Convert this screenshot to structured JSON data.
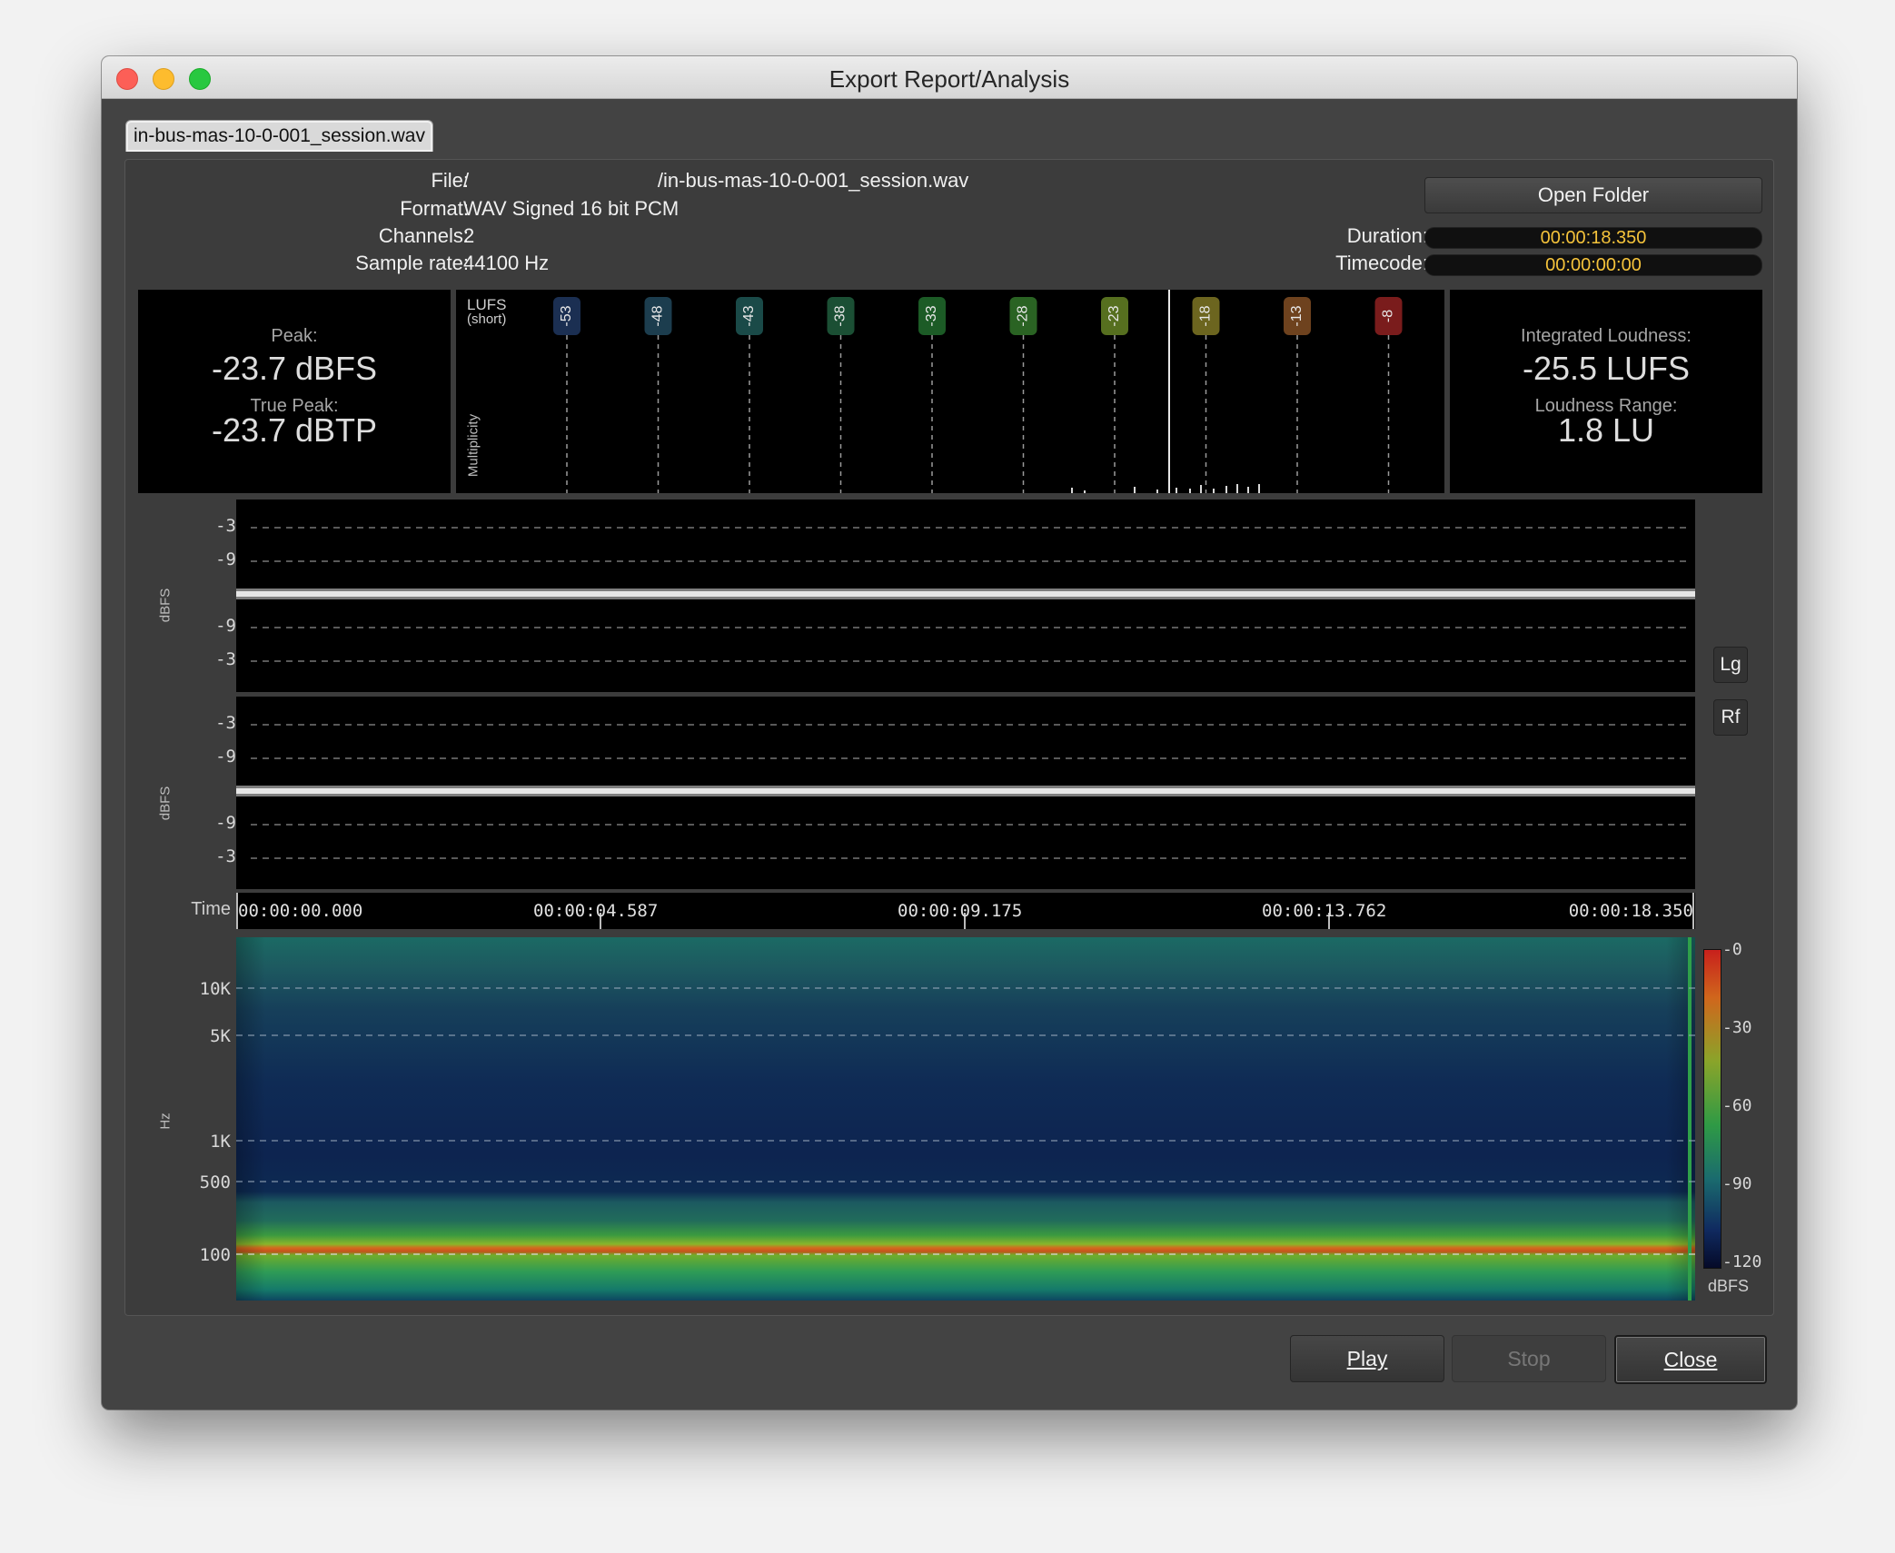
{
  "window": {
    "title": "Export Report/Analysis"
  },
  "tab": {
    "label": "in-bus-mas-10-0-001_session.wav"
  },
  "file_info": {
    "file_label": "File:",
    "file_value": "/                                  /in-bus-mas-10-0-001_session.wav",
    "format_label": "Format:",
    "format_value": "WAV Signed 16 bit PCM",
    "channels_label": "Channels:",
    "channels_value": "2",
    "rate_label": "Sample rate:",
    "rate_value": "44100 Hz"
  },
  "open_folder_label": "Open Folder",
  "duration": {
    "label": "Duration:",
    "value": "00:00:18.350"
  },
  "timecode": {
    "label": "Timecode:",
    "value": "00:00:00:00"
  },
  "peak_meter": {
    "peak_label": "Peak:",
    "peak_value": "-23.7 dBFS",
    "true_peak_label": "True Peak:",
    "true_peak_value": "-23.7 dBTP"
  },
  "histogram": {
    "title": "LUFS",
    "subtitle": "(short)",
    "y_label": "Multiplicity",
    "markers": [
      {
        "label": "-53",
        "color": "#1b2f52"
      },
      {
        "label": "-48",
        "color": "#1c3d4e"
      },
      {
        "label": "-43",
        "color": "#1a4a48"
      },
      {
        "label": "-38",
        "color": "#1b4f34"
      },
      {
        "label": "-33",
        "color": "#1c5b26"
      },
      {
        "label": "-28",
        "color": "#2a6323"
      },
      {
        "label": "-23",
        "color": "#566f1f"
      },
      {
        "label": "-18",
        "color": "#6c651f"
      },
      {
        "label": "-13",
        "color": "#6e421e"
      },
      {
        "label": "-8",
        "color": "#7a1c1c"
      }
    ]
  },
  "loudness_meter": {
    "integrated_label": "Integrated Loudness:",
    "integrated_value": "-25.5 LUFS",
    "range_label": "Loudness Range:",
    "range_value": "1.8 LU"
  },
  "waveform": {
    "y_label": "dBFS",
    "ticks": [
      "-3",
      "-9",
      "-9",
      "-3"
    ],
    "lg_label": "Lg",
    "rf_label": "Rf"
  },
  "timeline": {
    "label": "Time",
    "ticks": [
      "00:00:00.000",
      "00:00:04.587",
      "00:00:09.175",
      "00:00:13.762",
      "00:00:18.350"
    ]
  },
  "spectrogram": {
    "y_label": "Hz",
    "freq_ticks": [
      "10K",
      "5K",
      "1K",
      "500",
      "100"
    ],
    "scale_ticks": [
      "-0",
      "-30",
      "-60",
      "-90",
      "-120"
    ],
    "scale_unit": "dBFS"
  },
  "buttons": {
    "play": "Play",
    "stop": "Stop",
    "close": "Close"
  }
}
